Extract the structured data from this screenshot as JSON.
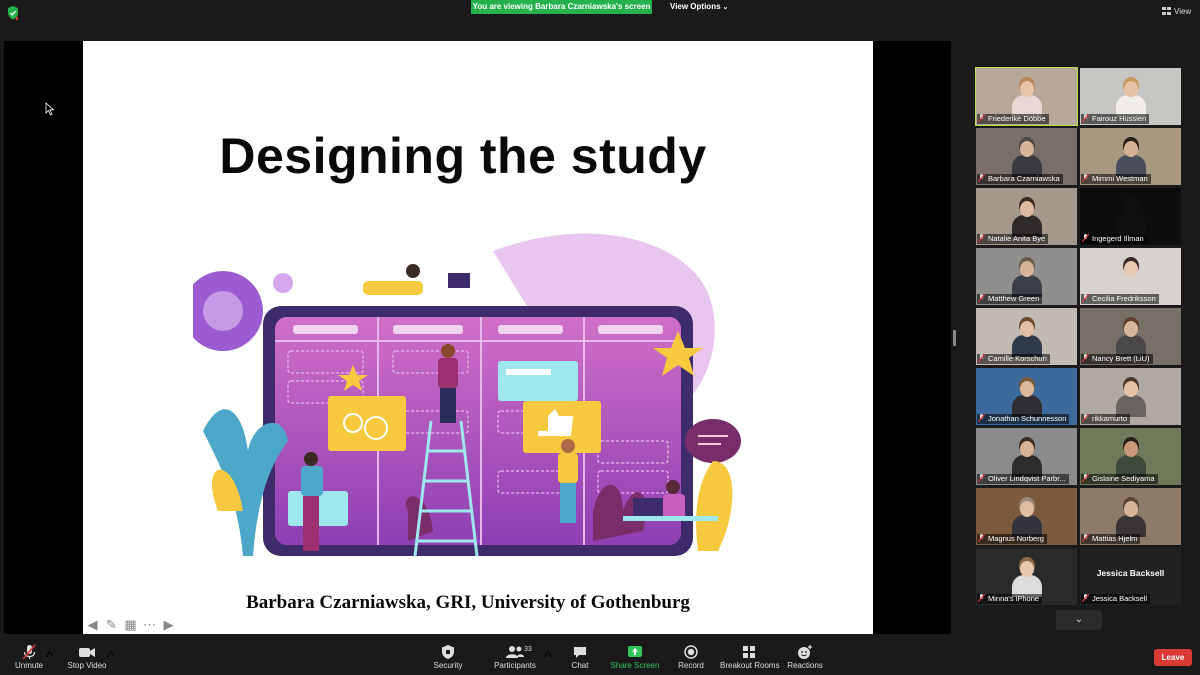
{
  "banner": {
    "viewing": "You are viewing Barbara Czarniawska's screen",
    "view_options": "View Options"
  },
  "view_label": "View",
  "slide": {
    "title": "Designing the study",
    "footer": "Barbara Czarniawska, GRI, University of Gothenburg"
  },
  "participants": [
    {
      "name": "Friederike Döbbe",
      "active": true,
      "skin": "#e7c3a8",
      "hair": "#b8865a",
      "shirt": "#e9d7d3",
      "bg": "#b9a79a"
    },
    {
      "name": "Fairouz Hussien",
      "skin": "#e8c2a4",
      "hair": "#c69a5e",
      "shirt": "#f1eee9",
      "bg": "#c7c6c2"
    },
    {
      "name": "Barbara Czarniawska",
      "skin": "#d8b49a",
      "hair": "#4a4a4a",
      "shirt": "#3a3a40",
      "bg": "#7a6f68"
    },
    {
      "name": "Mimmi Westman",
      "skin": "#d6b394",
      "hair": "#2b2118",
      "shirt": "#4b4f5c",
      "bg": "#a99880"
    },
    {
      "name": "Natalie Anita Bye",
      "skin": "#dfbaa0",
      "hair": "#3a2a22",
      "shirt": "#2e2a2a",
      "bg": "#a5978a"
    },
    {
      "name": "Ingegerd Illman",
      "skin": "#111111",
      "hair": "#111111",
      "shirt": "#111111",
      "bg": "#0d0d0d"
    },
    {
      "name": "Matthew Green",
      "skin": "#d9b39a",
      "hair": "#6b5b4b",
      "shirt": "#3b3f47",
      "bg": "#8f8f8d"
    },
    {
      "name": "Cecilia Fredriksson",
      "skin": "#e8c9b2",
      "hair": "#3a2a26",
      "shirt": "#d9d3cf",
      "bg": "#d7d2cd"
    },
    {
      "name": "Camille Korschun",
      "skin": "#e2bfa4",
      "hair": "#6a4a32",
      "shirt": "#2f3a4a",
      "bg": "#c1bbb3"
    },
    {
      "name": "Nancy Brett (LiU)",
      "skin": "#d8b69c",
      "hair": "#5b3e2c",
      "shirt": "#4a4848",
      "bg": "#777066"
    },
    {
      "name": "Jonathan Schunnesson",
      "skin": "#dcb79c",
      "hair": "#7a5a3c",
      "shirt": "#2e2e33",
      "bg": "#3d6a9c"
    },
    {
      "name": "rikkamurto",
      "skin": "#e4c3a7",
      "hair": "#4f3a2c",
      "shirt": "#6a6460",
      "bg": "#b1aaa2"
    },
    {
      "name": "Oliver Lindqvist Parbr...",
      "skin": "#d8b294",
      "hair": "#3a2e24",
      "shirt": "#2c2c2c",
      "bg": "#8a8c8c"
    },
    {
      "name": "Gislaine Sediyama",
      "skin": "#c89878",
      "hair": "#2a1f18",
      "shirt": "#3b4a3a",
      "bg": "#6f7a5a"
    },
    {
      "name": "Magnus Norberg",
      "skin": "#e0bca0",
      "hair": "#9a8a7a",
      "shirt": "#34353c",
      "bg": "#7b5a3e"
    },
    {
      "name": "Mattias Hjelm",
      "skin": "#d9b498",
      "hair": "#5a4534",
      "shirt": "#3a3535",
      "bg": "#8d7a68"
    },
    {
      "name": "Minna's iPhone",
      "skin": "#e8c8ae",
      "hair": "#8a6a48",
      "shirt": "#dcdcdc",
      "bg": "#2a2a2a"
    },
    {
      "name": "Jessica Backsell",
      "no_video": true,
      "display": "Jessica Backsell"
    }
  ],
  "toolbar": {
    "unmute": "Unmute",
    "stop_video": "Stop Video",
    "security": "Security",
    "participants": "Participants",
    "participants_count": "33",
    "chat": "Chat",
    "share_screen": "Share Screen",
    "record": "Record",
    "breakout": "Breakout Rooms",
    "reactions": "Reactions",
    "leave": "Leave"
  },
  "colors": {
    "banner": "#25b14b",
    "active_border": "#b5e04a",
    "leave": "#d93a34",
    "share": "#35c45c",
    "slide_bg": "#ffffff"
  }
}
